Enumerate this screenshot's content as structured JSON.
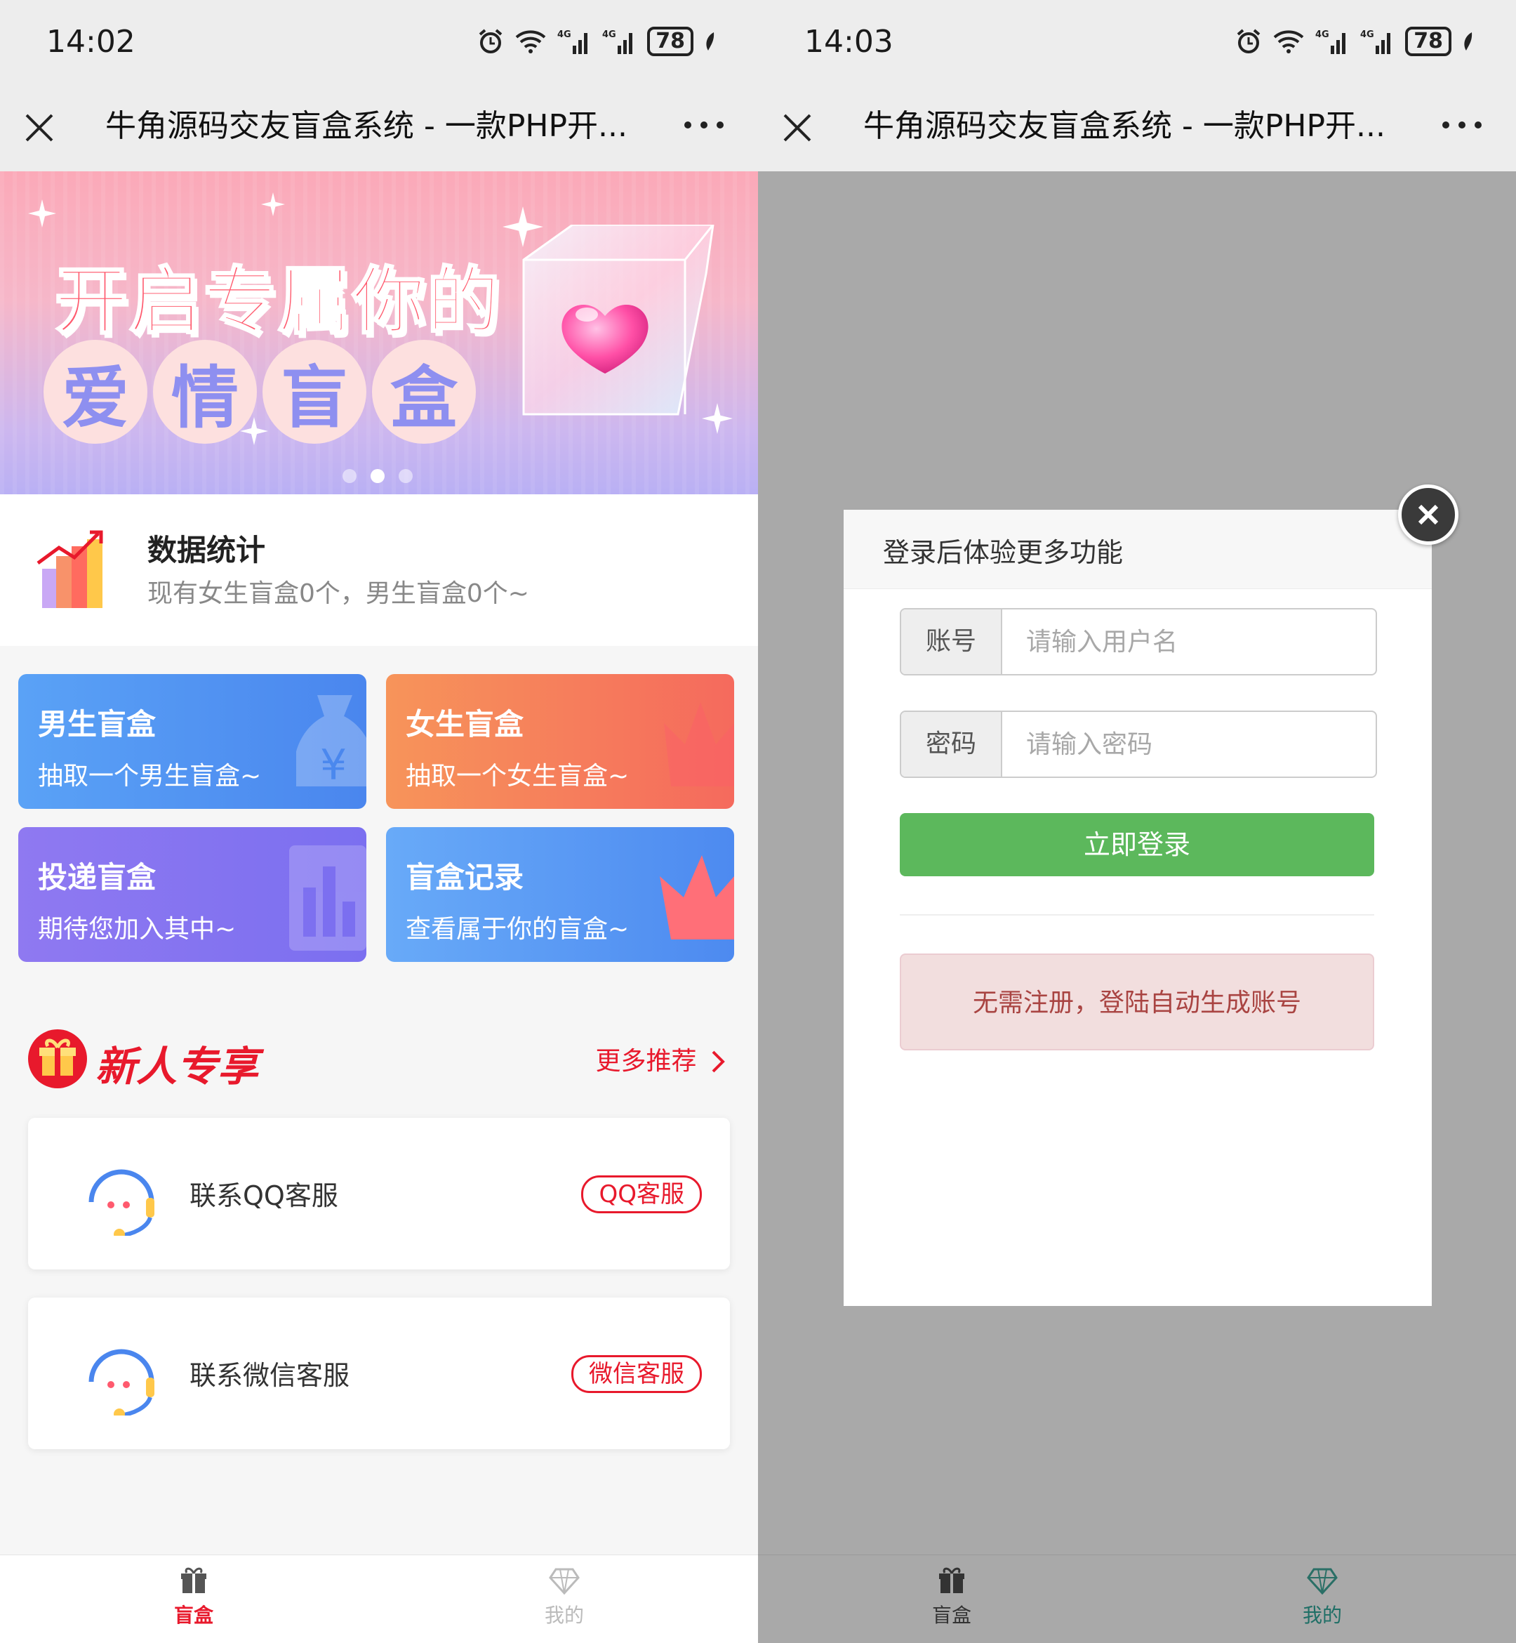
{
  "left": {
    "status": {
      "time": "14:02",
      "battery": "78"
    },
    "nav": {
      "title": "牛角源码交友盲盒系统 - 一款PHP开..."
    },
    "banner": {
      "line1": "开启专属你的",
      "line2": [
        "爱",
        "情",
        "盲",
        "盒"
      ]
    },
    "stats": {
      "title": "数据统计",
      "subtitle": "现有女生盲盒0个，男生盲盒0个~"
    },
    "cards": [
      {
        "title": "男生盲盒",
        "sub": "抽取一个男生盲盒~"
      },
      {
        "title": "女生盲盒",
        "sub": "抽取一个女生盲盒~"
      },
      {
        "title": "投递盲盒",
        "sub": "期待您加入其中~"
      },
      {
        "title": "盲盒记录",
        "sub": "查看属于你的盲盒~"
      }
    ],
    "newbie": {
      "title": "新人专享",
      "more": "更多推荐"
    },
    "services": [
      {
        "label": "联系QQ客服",
        "tag": "QQ客服"
      },
      {
        "label": "联系微信客服",
        "tag": "微信客服"
      }
    ],
    "tabs": [
      {
        "label": "盲盒",
        "icon": "gift-icon",
        "active": true
      },
      {
        "label": "我的",
        "icon": "diamond-icon",
        "active": false
      }
    ]
  },
  "right": {
    "status": {
      "time": "14:03",
      "battery": "78"
    },
    "nav": {
      "title": "牛角源码交友盲盒系统 - 一款PHP开..."
    },
    "dialog": {
      "title": "登录后体验更多功能",
      "account_label": "账号",
      "account_placeholder": "请输入用户名",
      "password_label": "密码",
      "password_placeholder": "请输入密码",
      "login_button": "立即登录",
      "notice": "无需注册，登陆自动生成账号"
    },
    "tabs": [
      {
        "label": "盲盒",
        "icon": "gift-icon",
        "active": false
      },
      {
        "label": "我的",
        "icon": "diamond-icon",
        "active": true
      }
    ]
  },
  "colors": {
    "accent_red": "#e8192c",
    "login_green": "#5cb85c",
    "active_tab_right": "#2a9d8f"
  }
}
